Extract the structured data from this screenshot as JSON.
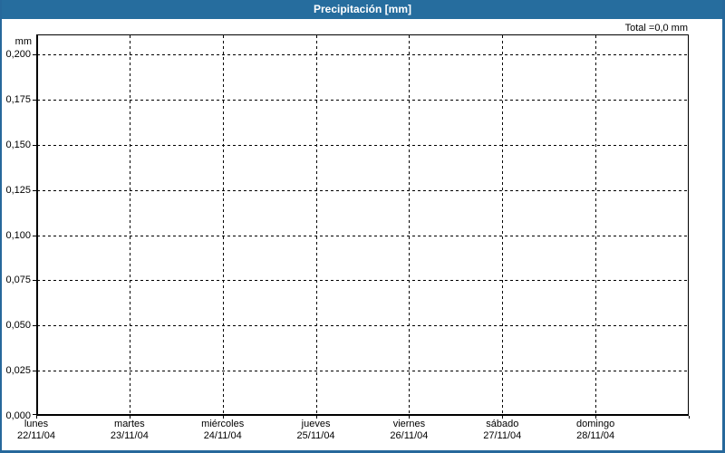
{
  "header": {
    "title": "Precipitación [mm]",
    "total": "Total =0,0 mm"
  },
  "colors": {
    "titlebar": "#266D9E",
    "window_border": "#26689B",
    "plot_border": "#000000",
    "grid": "#000000",
    "background": "#FFFFFF",
    "text": "#000000",
    "title_text": "#FFFFFF"
  },
  "chart_data": {
    "type": "bar",
    "title": "Precipitación [mm]",
    "unit": "mm",
    "xlabel": "",
    "ylabel": "mm",
    "total_annotation": "Total =0,0 mm",
    "ylim": [
      0,
      0.211
    ],
    "ytick_step": 0.025,
    "yticks": [
      "0,000",
      "0,025",
      "0,050",
      "0,075",
      "0,100",
      "0,125",
      "0,150",
      "0,175",
      "0,200"
    ],
    "grid": "dashed, horizontal at each y tick, vertical at each day boundary",
    "legend_position": "none",
    "days": [
      {
        "label": "lunes",
        "date": "22/11/04"
      },
      {
        "label": "martes",
        "date": "23/11/04"
      },
      {
        "label": "miércoles",
        "date": "24/11/04"
      },
      {
        "label": "jueves",
        "date": "25/11/04"
      },
      {
        "label": "viernes",
        "date": "26/11/04"
      },
      {
        "label": "sábado",
        "date": "27/11/04"
      },
      {
        "label": "domingo",
        "date": "28/11/04"
      }
    ],
    "series": [
      {
        "name": "Precipitación",
        "values": [
          0,
          0,
          0,
          0,
          0,
          0,
          0
        ]
      }
    ],
    "total_mm": 0.0
  }
}
